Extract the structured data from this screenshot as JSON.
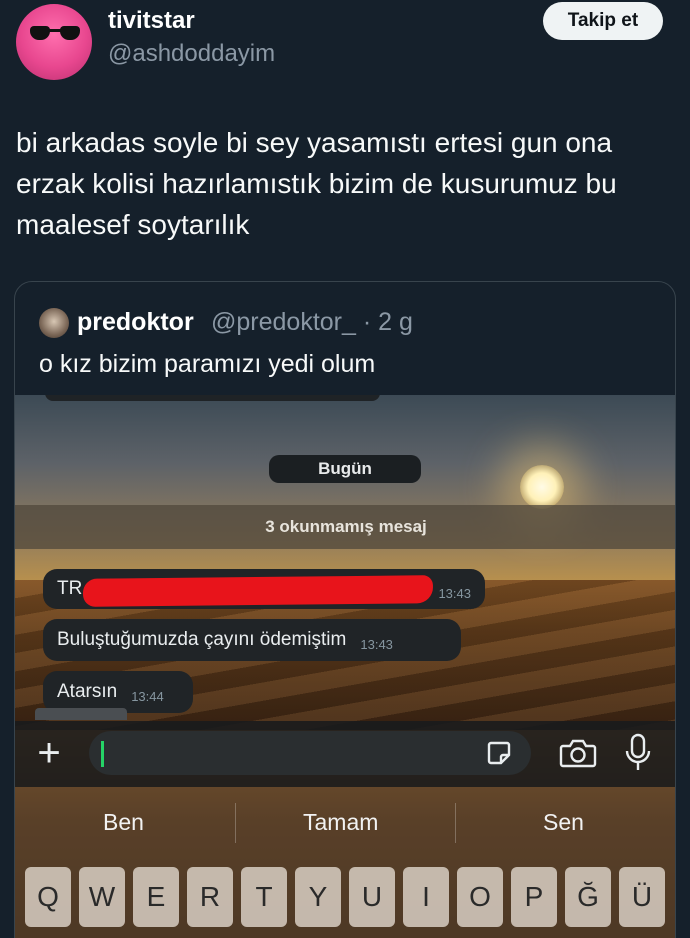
{
  "author": {
    "display_name": "tivitstar",
    "handle": "@ashdoddayim",
    "follow_label": "Takip et"
  },
  "tweet": {
    "text": "bi arkadas soyle bi sey yasamıstı ertesi gun ona erzak kolisi hazırlamıstık bizim de kusurumuz bu maalesef soytarılık"
  },
  "quoted": {
    "name": "predoktor",
    "meta": "@predoktor_ · 2 g",
    "text": "o kız bizim paramızı yedi olum"
  },
  "chat": {
    "date_label": "Bugün",
    "unread_label": "3 okunmamış mesaj",
    "messages": [
      {
        "text": "TR",
        "time": "13:43"
      },
      {
        "text": "Buluştuğumuzda çayını ödemiştim",
        "time": "13:43"
      },
      {
        "text": "Atarsın",
        "time": "13:44"
      }
    ]
  },
  "suggestions": [
    "Ben",
    "Tamam",
    "Sen"
  ],
  "keyboard": {
    "keys": [
      "Q",
      "W",
      "E",
      "R",
      "T",
      "Y",
      "U",
      "I",
      "O",
      "P",
      "Ğ",
      "Ü"
    ]
  },
  "colors": {
    "background": "#15202b",
    "redaction": "#e8141b",
    "cursor": "#25d366"
  },
  "icons": [
    "plus-icon",
    "sticker-icon",
    "camera-icon",
    "microphone-icon"
  ]
}
